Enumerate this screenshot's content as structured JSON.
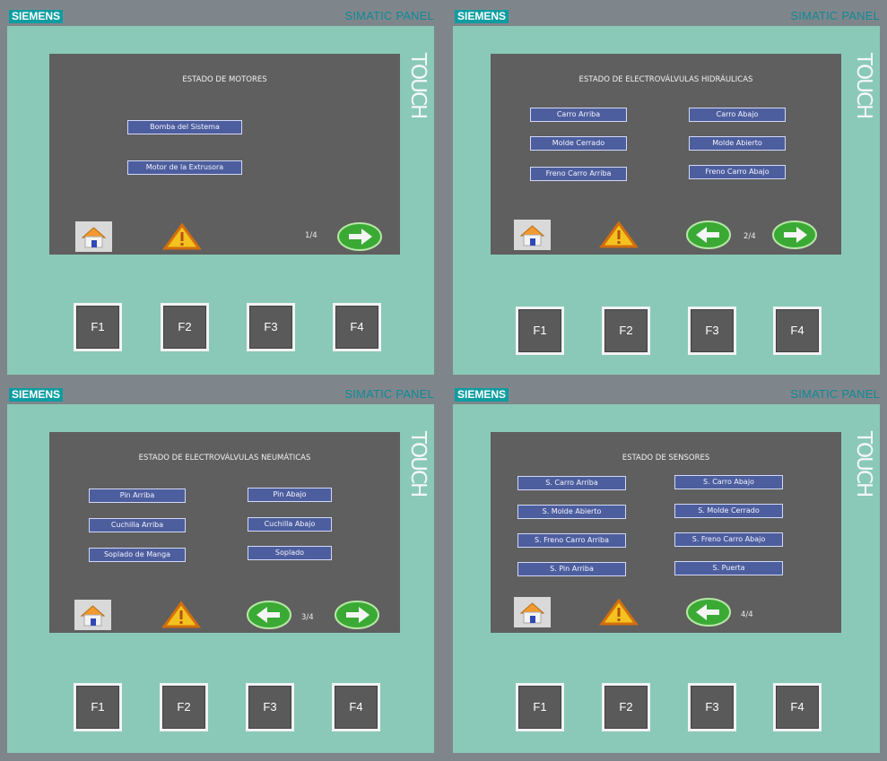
{
  "brand": "SIEMENS",
  "model": "SIMATIC PANEL",
  "touch_label": "TOUCH",
  "fkeys": [
    "F1",
    "F2",
    "F3",
    "F4"
  ],
  "panels": [
    {
      "title": "ESTADO DE MOTORES",
      "page": "1/4",
      "buttons": [
        "Bomba del Sistema",
        "Motor de la Extrusora"
      ]
    },
    {
      "title": "ESTADO DE ELECTROVÁLVULAS HIDRÁULICAS",
      "page": "2/4",
      "buttons": [
        "Carro Arriba",
        "Carro Abajo",
        "Molde Cerrado",
        "Molde Abierto",
        "Freno Carro Arriba",
        "Freno Carro Abajo"
      ]
    },
    {
      "title": "ESTADO DE ELECTROVÁLVULAS NEUMÁTICAS",
      "page": "3/4",
      "buttons": [
        "Pin Arriba",
        "Pin Abajo",
        "Cuchilla Arriba",
        "Cuchilla Abajo",
        "Soplado de Manga",
        "Soplado"
      ]
    },
    {
      "title": "ESTADO DE SENSORES",
      "page": "4/4",
      "buttons": [
        "S. Carro Arriba",
        "S. Carro Abajo",
        "S. Molde Abierto",
        "S. Molde Cerrado",
        "S. Freno Carro Arriba",
        "S. Freno Carro Abajo",
        "S. Pin Arriba",
        "S. Puerta"
      ]
    }
  ],
  "icons": {
    "home": "home-icon",
    "alarm": "warning-icon",
    "prev": "arrow-left-icon",
    "next": "arrow-right-icon"
  },
  "colors": {
    "panel_bezel": "#8ac9b7",
    "screen": "#5f5f5f",
    "button": "#4d5e9e",
    "brand": "#0d9da1"
  }
}
